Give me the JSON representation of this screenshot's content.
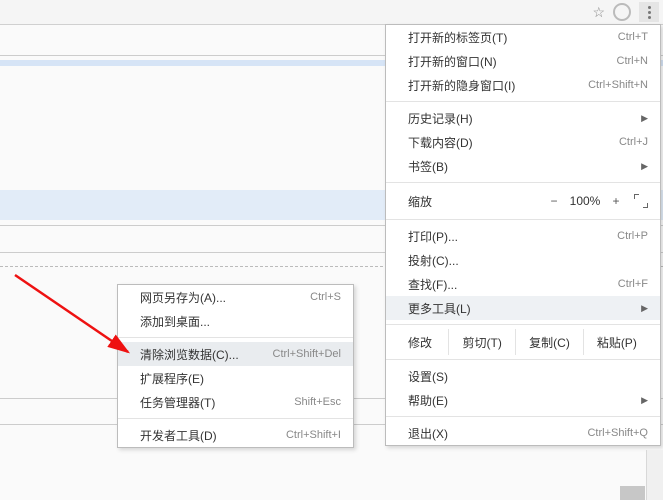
{
  "main_menu": {
    "new_tab": {
      "label": "打开新的标签页(T)",
      "shortcut": "Ctrl+T"
    },
    "new_window": {
      "label": "打开新的窗口(N)",
      "shortcut": "Ctrl+N"
    },
    "incognito": {
      "label": "打开新的隐身窗口(I)",
      "shortcut": "Ctrl+Shift+N"
    },
    "history": {
      "label": "历史记录(H)"
    },
    "downloads": {
      "label": "下载内容(D)",
      "shortcut": "Ctrl+J"
    },
    "bookmarks": {
      "label": "书签(B)"
    },
    "zoom": {
      "label": "缩放",
      "minus": "−",
      "value": "100%",
      "plus": "+"
    },
    "print": {
      "label": "打印(P)...",
      "shortcut": "Ctrl+P"
    },
    "cast": {
      "label": "投射(C)..."
    },
    "find": {
      "label": "查找(F)...",
      "shortcut": "Ctrl+F"
    },
    "more_tools": {
      "label": "更多工具(L)"
    },
    "edit": {
      "label": "修改",
      "cut": "剪切(T)",
      "copy": "复制(C)",
      "paste": "粘贴(P)"
    },
    "settings": {
      "label": "设置(S)"
    },
    "help": {
      "label": "帮助(E)"
    },
    "exit": {
      "label": "退出(X)",
      "shortcut": "Ctrl+Shift+Q"
    }
  },
  "sub_menu": {
    "save_as": {
      "label": "网页另存为(A)...",
      "shortcut": "Ctrl+S"
    },
    "add_to_desktop": {
      "label": "添加到桌面..."
    },
    "clear_data": {
      "label": "清除浏览数据(C)...",
      "shortcut": "Ctrl+Shift+Del"
    },
    "extensions": {
      "label": "扩展程序(E)"
    },
    "task_manager": {
      "label": "任务管理器(T)",
      "shortcut": "Shift+Esc"
    },
    "dev_tools": {
      "label": "开发者工具(D)",
      "shortcut": "Ctrl+Shift+I"
    }
  }
}
